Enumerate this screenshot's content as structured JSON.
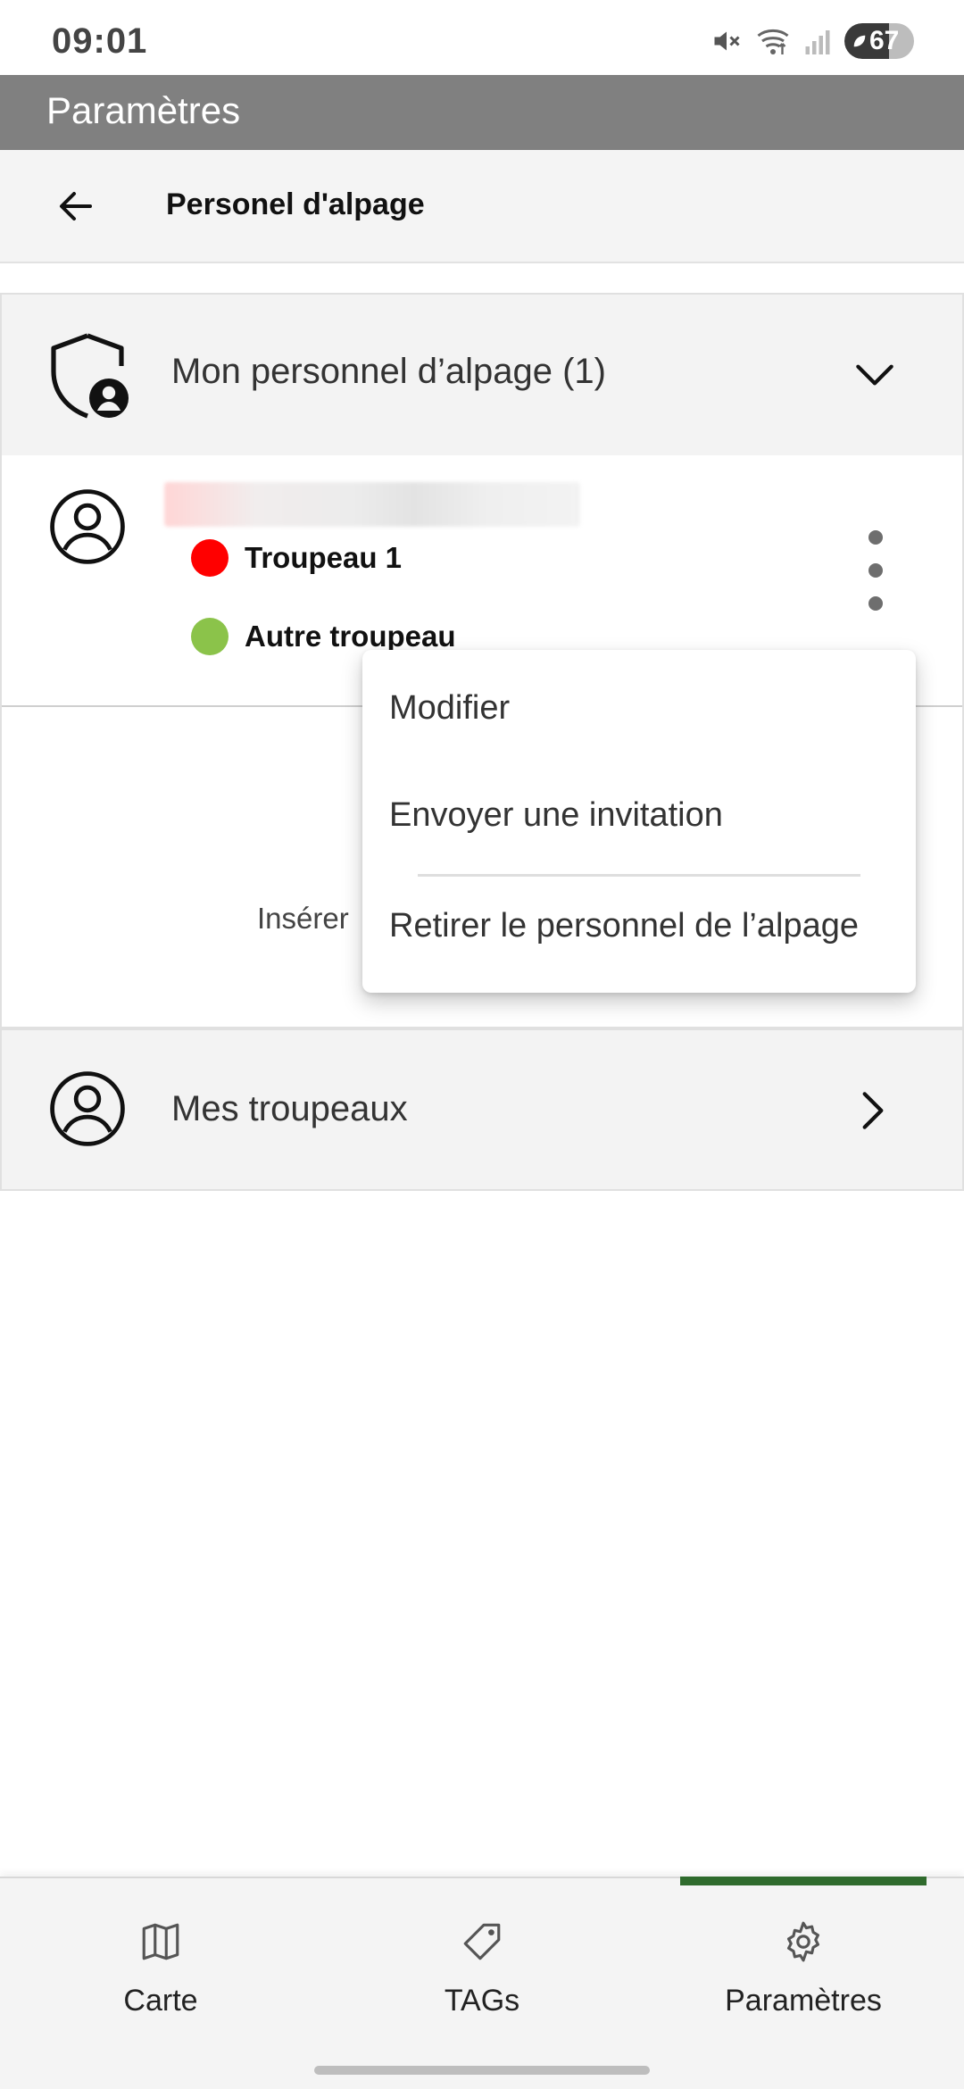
{
  "status_bar": {
    "time": "09:01",
    "battery": "67"
  },
  "app_header": {
    "title": "Paramètres"
  },
  "sub_header": {
    "title": "Personel d'alpage"
  },
  "staff_section": {
    "label": "Mon personnel d’alpage (1)",
    "member": {
      "herds": [
        {
          "name": "Troupeau 1",
          "color": "#ff0000"
        },
        {
          "name": "Autre troupeau",
          "color": "#8bc34a"
        }
      ]
    },
    "insert_text": "Insérer"
  },
  "herds_section": {
    "label": "Mes troupeaux"
  },
  "context_menu": {
    "items": [
      "Modifier",
      "Envoyer une invitation",
      "Retirer le personnel de l’alpage"
    ]
  },
  "bottom_nav": {
    "items": [
      {
        "label": "Carte",
        "icon": "map-icon"
      },
      {
        "label": "TAGs",
        "icon": "tag-icon"
      },
      {
        "label": "Paramètres",
        "icon": "gear-icon"
      }
    ],
    "active_index": 2,
    "accent": "#2f6b2d"
  }
}
